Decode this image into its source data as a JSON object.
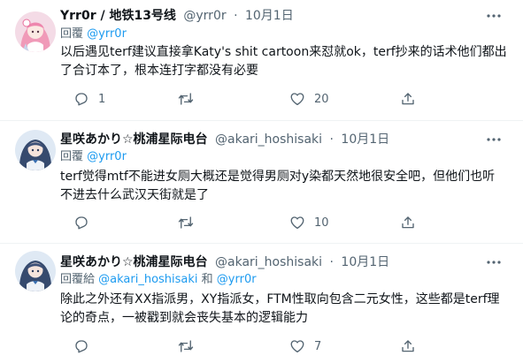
{
  "tweets": [
    {
      "name": "Yrr0r / 地铁13号线",
      "handle": "@yrr0r",
      "dot": "·",
      "date": "10月1日",
      "replying_prefix": "回覆 ",
      "mention1": "@yrr0r",
      "mention_joiner": "",
      "mention2": "",
      "text": "以后遇见terf建议直接拿Katy's shit cartoon来怼就ok，terf抄来的话术他们都出了合订本了，根本连打字都没有必要",
      "reply_count": "1",
      "retweet_count": "",
      "like_count": "20"
    },
    {
      "name": "星咲あかり☆桃浦星际电台",
      "handle": "@akari_hoshisaki",
      "dot": "·",
      "date": "10月1日",
      "replying_prefix": "回覆 ",
      "mention1": "@yrr0r",
      "mention_joiner": "",
      "mention2": "",
      "text": "terf觉得mtf不能进女厕大概还是觉得男厕对y染都天然地很安全吧，但他们也听不进去什么武汉天街就是了",
      "reply_count": "",
      "retweet_count": "",
      "like_count": "10"
    },
    {
      "name": "星咲あかり☆桃浦星际电台",
      "handle": "@akari_hoshisaki",
      "dot": "·",
      "date": "10月1日",
      "replying_prefix": "回覆給 ",
      "mention1": "@akari_hoshisaki",
      "mention_joiner": " 和 ",
      "mention2": "@yrr0r",
      "text": "除此之外还有XX指派男，XY指派女，FTM性取向包含二元女性，这些都是terf理论的奇点，一被戳到就会丧失基本的逻辑能力",
      "reply_count": "",
      "retweet_count": "",
      "like_count": "7"
    }
  ],
  "colors": {
    "text": "#0f1419",
    "secondary": "#536471",
    "link": "#1d9bf0",
    "divider": "#eff3f4"
  },
  "icons": {
    "reply": "reply-icon",
    "retweet": "retweet-icon",
    "like": "like-icon",
    "share": "share-icon",
    "more": "more-icon"
  }
}
